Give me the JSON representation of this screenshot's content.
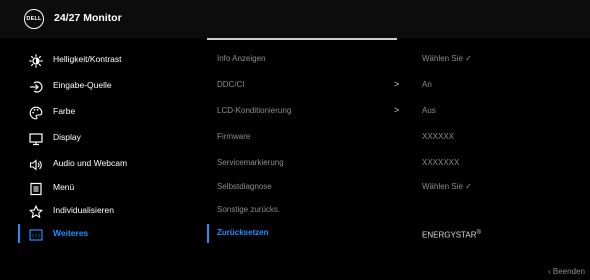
{
  "header": {
    "logo_text": "DELL",
    "title": "24/27 Monitor"
  },
  "menu": [
    {
      "label": "Helligkeit/Kontrast",
      "icon": "brightness-icon"
    },
    {
      "label": "Eingabe-Quelle",
      "icon": "input-source-icon"
    },
    {
      "label": "Farbe",
      "icon": "color-palette-icon"
    },
    {
      "label": "Display",
      "icon": "display-monitor-icon"
    },
    {
      "label": "Audio und Webcam",
      "icon": "speaker-icon"
    },
    {
      "label": "Menü",
      "icon": "menu-list-icon"
    },
    {
      "label": "Individualisieren",
      "icon": "star-icon"
    },
    {
      "label": "Weiteres",
      "icon": "others-icon",
      "active": true
    }
  ],
  "submenu": [
    {
      "label": "Info Anzeigen",
      "value": "Wählen Sie",
      "value_check": true
    },
    {
      "label": "DDC/CI",
      "chevron": ">",
      "value": "An"
    },
    {
      "label": "LCD-Konditionierung",
      "chevron": ">",
      "value": "Aus"
    },
    {
      "label": "Firmware",
      "value": "XXXXXX"
    },
    {
      "label": "Servicemarkierung",
      "value": "XXXXXXX"
    },
    {
      "label": "Selbstdiagnose",
      "value": "Wählen Sie",
      "value_check": true
    },
    {
      "label": "Sonstige zurücks.",
      "value": ""
    },
    {
      "label": "Zurücksetzen",
      "active": true,
      "value": "ENERGYSTAR",
      "value_sup": "®"
    }
  ],
  "footer": {
    "exit_label": "‹ Beenden"
  },
  "colors": {
    "accent": "#1e90ff",
    "background": "#000000",
    "header_bg": "#0c0c0c",
    "muted_text": "#8c8c8c"
  }
}
